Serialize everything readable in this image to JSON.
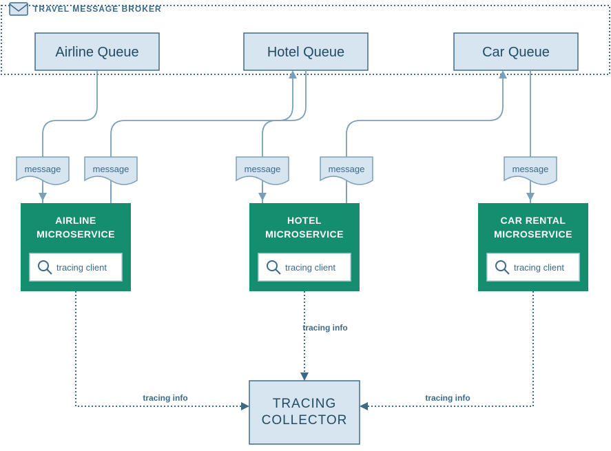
{
  "broker": {
    "label": "TRAVEL MESSAGE BROKER"
  },
  "queues": {
    "airline": "Airline Queue",
    "hotel": "Hotel Queue",
    "car": "Car Queue"
  },
  "message_label": "message",
  "services": {
    "airline": {
      "l1": "AIRLINE",
      "l2": "MICROSERVICE",
      "client": "tracing client"
    },
    "hotel": {
      "l1": "HOTEL",
      "l2": "MICROSERVICE",
      "client": "tracing client"
    },
    "car": {
      "l1": "CAR RENTAL",
      "l2": "MICROSERVICE",
      "client": "tracing client"
    }
  },
  "tracing_info_label": "tracing info",
  "collector": {
    "l1": "TRACING",
    "l2": "COLLECTOR"
  }
}
